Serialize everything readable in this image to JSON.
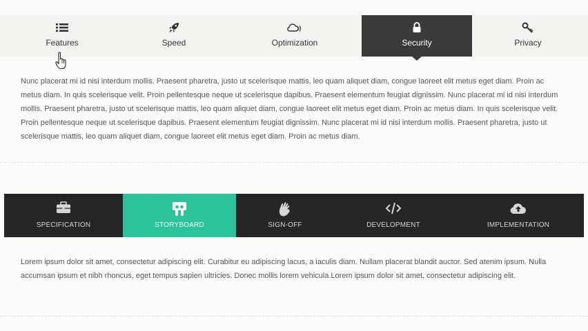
{
  "top_tabs": [
    {
      "label": "Features",
      "icon": "list-icon"
    },
    {
      "label": "Speed",
      "icon": "rocket-icon"
    },
    {
      "label": "Optimization",
      "icon": "cloud-signal-icon"
    },
    {
      "label": "Security",
      "icon": "lock-icon",
      "active": true
    },
    {
      "label": "Privacy",
      "icon": "key-icon"
    }
  ],
  "paragraph_top": "Nunc placerat mi id nisi interdum mollis. Praesent pharetra, justo ut scelerisque mattis, leo quam aliquet diam, congue laoreet elit metus eget diam. Proin ac metus diam. In quis scelerisque velit. Proin pellentesque neque ut scelerisque dapibus. Praesent elementum feugiat dignissim. Nunc placerat mi id nisi interdum mollis. Praesent pharetra, justo ut scelerisque mattis, leo quam aliquet diam, congue laoreet elit metus eget diam. Proin ac metus diam. In quis scelerisque velit. Proin pellentesque neque ut scelerisque dapibus. Praesent elementum feugiat dignissim. Nunc placerat mi id nisi interdum mollis. Praesent pharetra, justo ut scelerisque mattis, leo quam aliquet diam, congue laoreet elit metus eget diam. Proin ac metus diam.",
  "bottom_tabs": [
    {
      "label": "SPECIFICATION",
      "icon": "briefcase-icon"
    },
    {
      "label": "STORYBOARD",
      "icon": "slideshare-icon",
      "active": true
    },
    {
      "label": "SIGN-OFF",
      "icon": "hand-icon"
    },
    {
      "label": "DEVELOPMENT",
      "icon": "code-icon"
    },
    {
      "label": "IMPLEMENTATION",
      "icon": "cloud-upload-icon"
    }
  ],
  "paragraph_bottom": "Lorem ipsum dolor sit amet, consectetur adipiscing elit. Curabitur eu adipiscing lacus, a iaculis diam. Nullam placerat blandit auctor. Sed atenim ipsum. Nulla accumsan ipsum et nibh rhoncus, eget tempus sapien ultricies. Donec mollis lorem vehicula.Lorem ipsum dolor sit amet, consectetur adipiscing elit.",
  "colors": {
    "active_top": "#3a3a3a",
    "bottom_bar": "#262626",
    "active_bottom": "#2ac39b"
  }
}
